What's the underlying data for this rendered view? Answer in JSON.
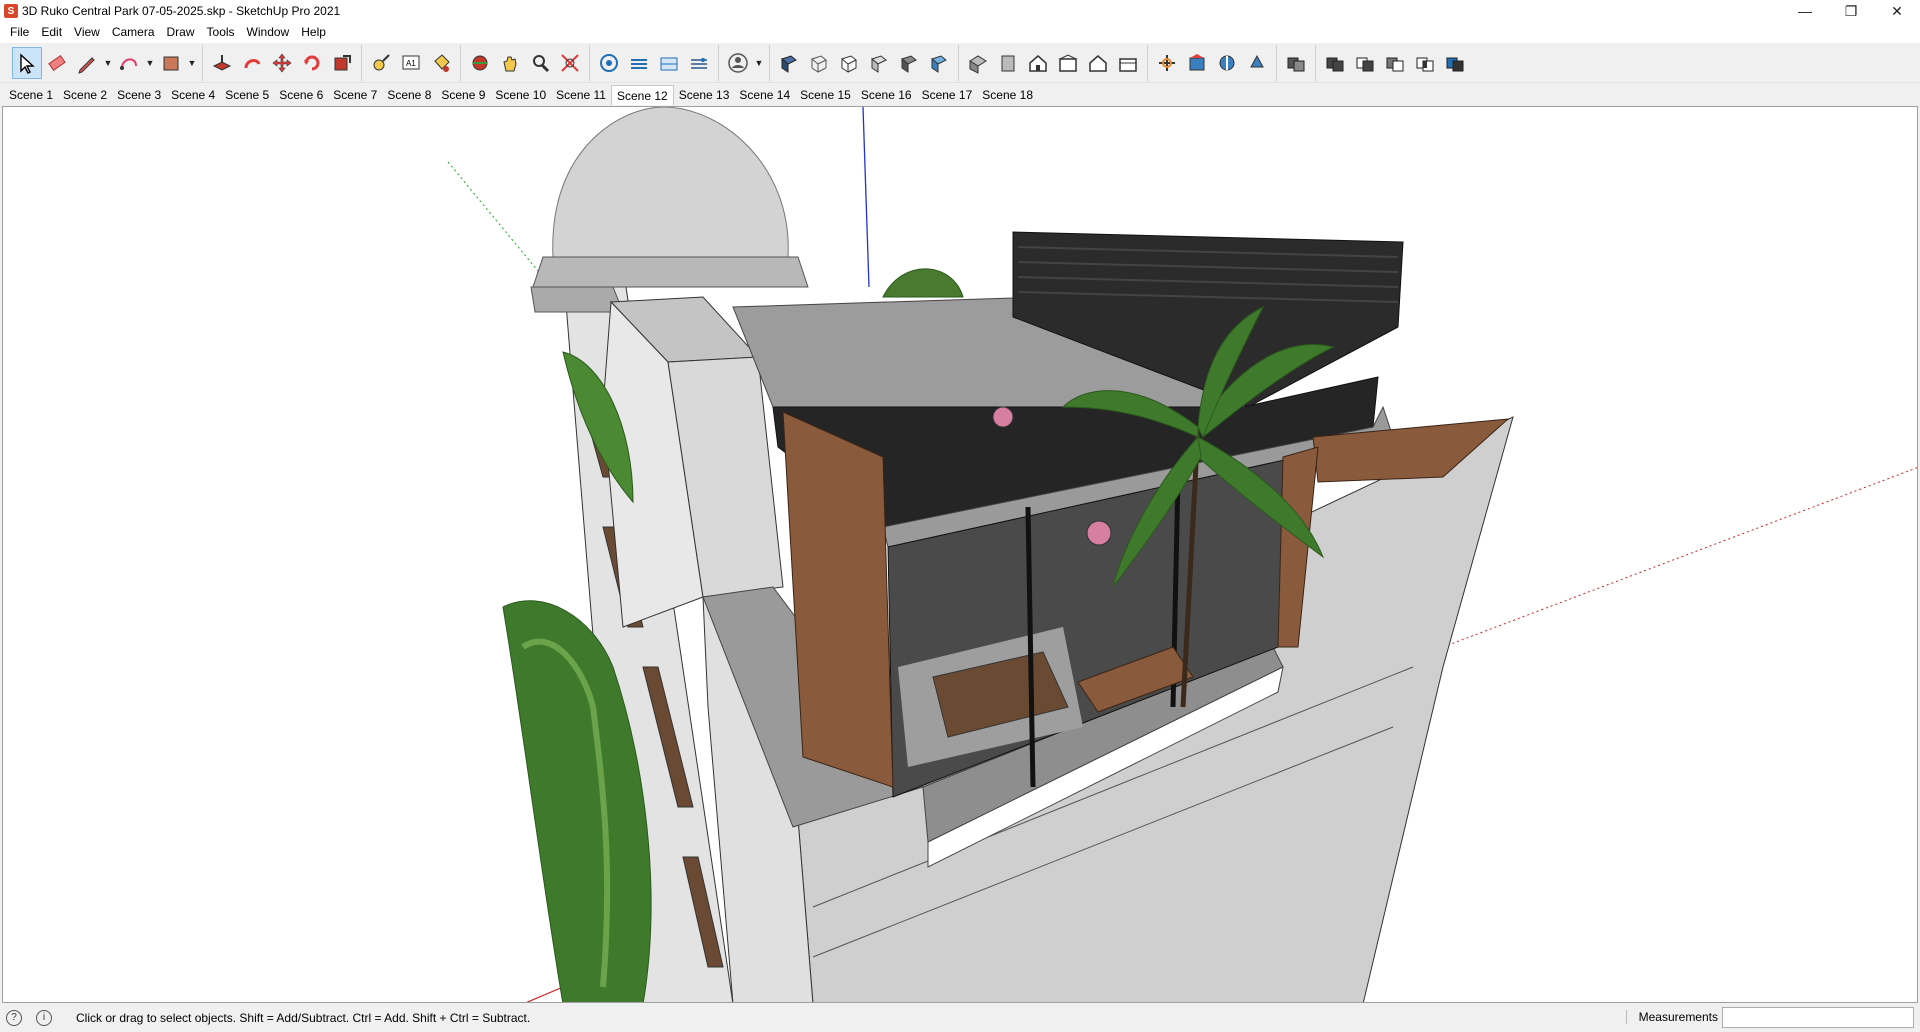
{
  "window": {
    "title": "3D Ruko Central Park 07-05-2025.skp - SketchUp Pro 2021",
    "controls": {
      "minimize": "—",
      "restore": "❐",
      "close": "✕"
    }
  },
  "menu": [
    "File",
    "Edit",
    "View",
    "Camera",
    "Draw",
    "Tools",
    "Window",
    "Help"
  ],
  "toolbar": {
    "groups": [
      [
        "select-tool",
        "eraser-tool",
        "pencil-line-tool",
        "arc-tool",
        "rectangle-tool"
      ],
      [
        "push-pull-tool",
        "offset-tool",
        "move-tool",
        "rotate-tool",
        "scale-tool"
      ],
      [
        "tape-measure-tool",
        "text-tool",
        "paint-bucket-tool"
      ],
      [
        "orbit-tool",
        "pan-tool",
        "zoom-tool",
        "zoom-extents-tool"
      ],
      [
        "warehouse-tool",
        "extension-warehouse-tool",
        "layout-tool",
        "extension-manager-tool"
      ],
      [
        "user-account-tool"
      ],
      [
        "xray-style-tool",
        "wireframe-style-tool",
        "hidden-line-style-tool",
        "shaded-style-tool",
        "shaded-textures-style-tool",
        "monochrome-style-tool"
      ],
      [
        "iso-view-tool",
        "top-view-tool",
        "front-view-tool",
        "right-view-tool",
        "back-view-tool",
        "left-view-tool"
      ],
      [
        "section-plane-tool",
        "section-display-tool",
        "section-cuts-tool",
        "section-fill-tool"
      ],
      [
        "outer-shell-tool"
      ],
      [
        "solid-union-tool",
        "solid-subtract-tool",
        "solid-trim-tool",
        "solid-intersect-tool",
        "solid-split-tool"
      ]
    ],
    "active": "select-tool",
    "accent": "#cce4f7"
  },
  "scenes": {
    "tabs": [
      "Scene 1",
      "Scene 2",
      "Scene 3",
      "Scene 4",
      "Scene 5",
      "Scene 6",
      "Scene 7",
      "Scene 8",
      "Scene 9",
      "Scene 10",
      "Scene 11",
      "Scene 12",
      "Scene 13",
      "Scene 14",
      "Scene 15",
      "Scene 16",
      "Scene 17",
      "Scene 18"
    ],
    "active_index": 11
  },
  "status": {
    "hint": "Click or drag to select objects. Shift = Add/Subtract. Ctrl = Add. Shift + Ctrl = Subtract.",
    "measurements_label": "Measurements",
    "measurements_value": ""
  },
  "colors": {
    "axis_blue": "#2233cc",
    "axis_red": "#cc2222",
    "axis_green": "#22aa22",
    "wall": "#cfcfcf",
    "dark_frame": "#262626",
    "wood": "#8a5a3c",
    "gravel": "#9a9a9a",
    "foliage": "#3f7a2c"
  }
}
